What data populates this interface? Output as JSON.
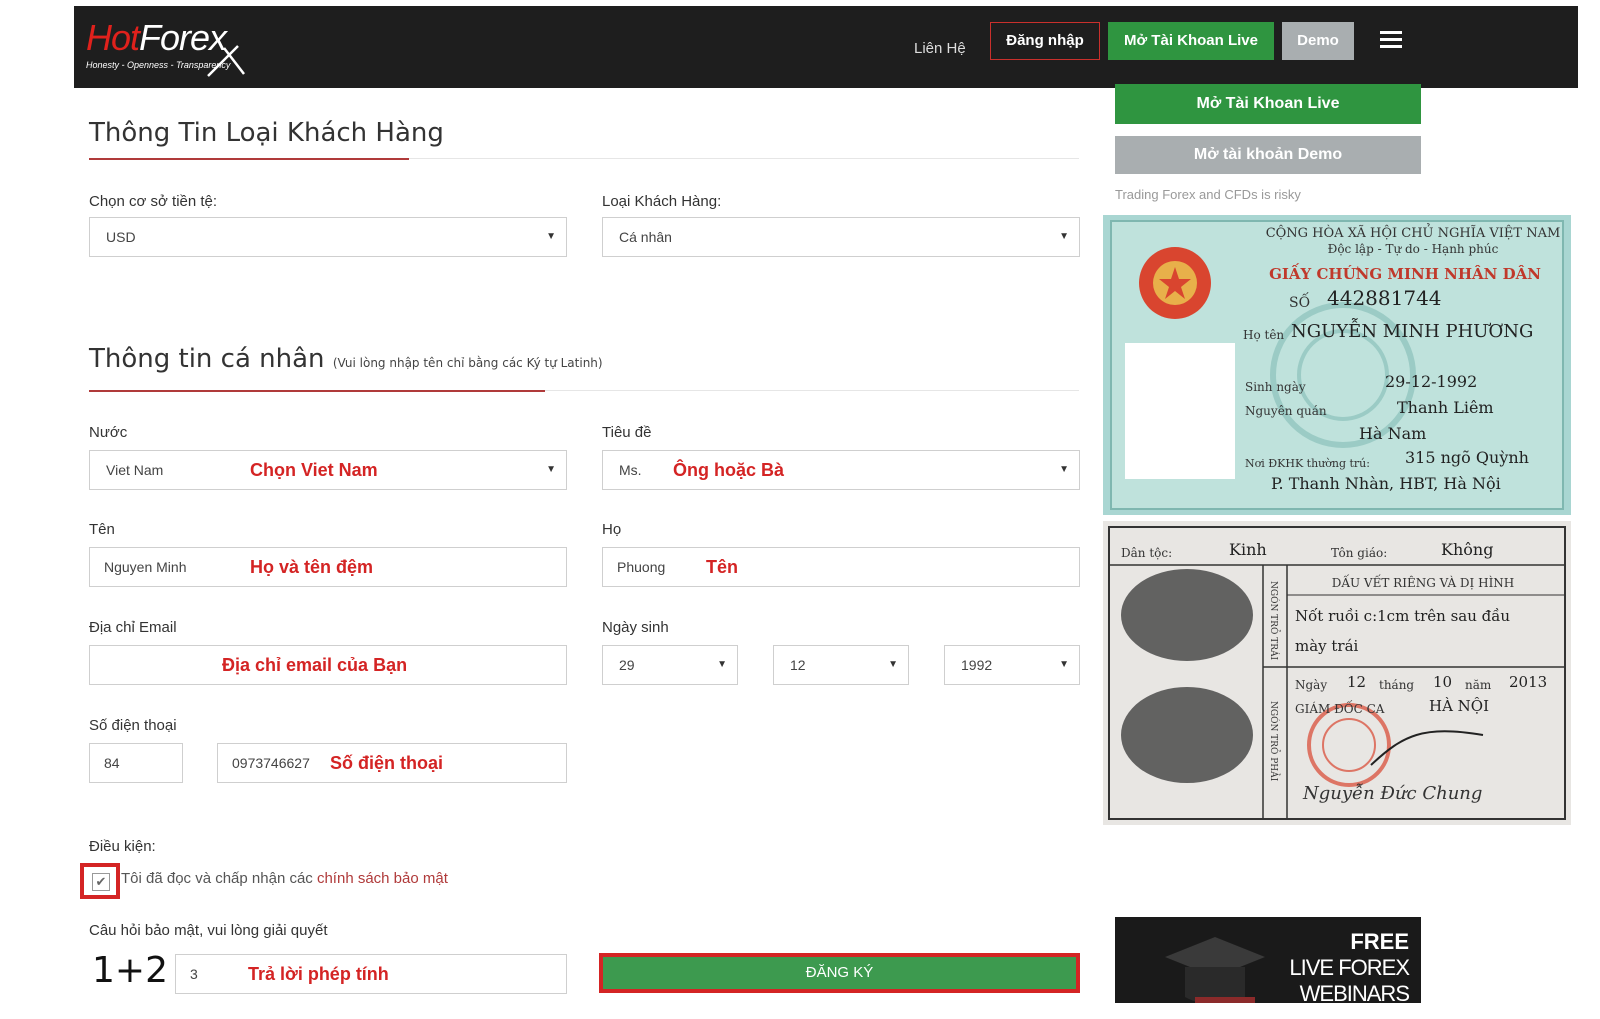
{
  "header": {
    "logo_hot": "Hot",
    "logo_forex": "Forex",
    "logo_tagline": "Honesty - Openness - Transparency",
    "nav_contact": "Liên Hệ",
    "nav_login": "Đăng nhập",
    "nav_open_live": "Mở Tài Khoan Live",
    "nav_demo": "Demo"
  },
  "section1": {
    "title": "Thông Tin Loại Khách Hàng",
    "currency_label": "Chọn cơ sở tiền tệ:",
    "currency_value": "USD",
    "client_type_label": "Loại Khách Hàng:",
    "client_type_value": "Cá nhân"
  },
  "section2": {
    "title": "Thông tin cá nhân",
    "subtitle": "(Vui lòng nhập tên chỉ bằng các Ký tự Latinh)",
    "country_label": "Nước",
    "country_value": "Viet Nam",
    "country_hint": "Chọn Viet Nam",
    "title_label": "Tiêu đề",
    "title_value": "Ms.",
    "title_hint": "Ông hoặc Bà",
    "firstname_label": "Tên",
    "firstname_value": "Nguyen Minh",
    "firstname_hint": "Họ và tên đệm",
    "lastname_label": "Họ",
    "lastname_value": "Phuong",
    "lastname_hint": "Tên",
    "email_label": "Địa chỉ Email",
    "email_hint": "Địa chỉ email của Bạn",
    "dob_label": "Ngày sinh",
    "dob_day": "29",
    "dob_month": "12",
    "dob_year": "1992",
    "phone_label": "Số điện thoại",
    "phone_code": "84",
    "phone_value": "0973746627",
    "phone_hint": "Số điện thoại"
  },
  "terms": {
    "label": "Điều kiện:",
    "text": "Tôi đã đọc và chấp nhận các ",
    "link": "chính sách bảo mật",
    "checked": true
  },
  "captcha": {
    "label": "Câu hỏi bảo mật, vui lòng giải quyết",
    "question": "1+2",
    "answer": "3",
    "hint": "Trả lời phép tính"
  },
  "submit_label": "ĐĂNG KÝ",
  "sidebar": {
    "open_live": "Mở Tài Khoan Live",
    "open_demo": "Mở tài khoản Demo",
    "risk": "Trading Forex and CFDs is risky",
    "banner_line1": "FREE",
    "banner_line2": "LIVE FOREX",
    "banner_line3": "WEBINARS"
  },
  "id_card": {
    "front_line1": "CỘNG HÒA XÃ HỘI CHỦ NGHĨA VIỆT NAM",
    "front_line2": "Độc lập - Tự do - Hạnh phúc",
    "front_title": "GIẤY CHỨNG MINH NHÂN DÂN",
    "number_label": "SỐ",
    "number": "442881744",
    "name_label": "Họ tên",
    "name": "NGUYỄN MINH PHƯƠNG",
    "dob_label": "Sinh ngày",
    "dob": "29-12-1992",
    "origin_label": "Nguyên quán",
    "origin1": "Thanh Liêm",
    "origin2": "Hà Nam",
    "address_label": "Nơi ĐKHK thường trú:",
    "address1": "315 ngõ Quỳnh",
    "address2": "P. Thanh Nhàn, HBT, Hà Nội",
    "ethnic_label": "Dân tộc:",
    "ethnic": "Kinh",
    "religion_label": "Tôn giáo:",
    "religion": "Không",
    "marks_title": "DẤU VẾT RIÊNG VÀ DỊ HÌNH",
    "marks1": "Nốt ruồi c:1cm trên sau đầu",
    "marks2": "mày trái",
    "left_finger": "NGÓN TRỎ TRÁI",
    "right_finger": "NGÓN TRỎ PHẢI",
    "issue_day_label": "Ngày",
    "issue_day": "12",
    "issue_month_label": "tháng",
    "issue_month": "10",
    "issue_year_label": "năm",
    "issue_year": "2013",
    "director_label": "GIÁM ĐỐC CA",
    "director_city": "HÀ NỘI",
    "signer": "Nguyễn Đức Chung"
  },
  "colors": {
    "header_bg": "#1e1e1e",
    "green": "#2f9540",
    "grey_button": "#a9aeb0",
    "annotation_red": "#d42424",
    "brand_red": "#e0211c"
  }
}
